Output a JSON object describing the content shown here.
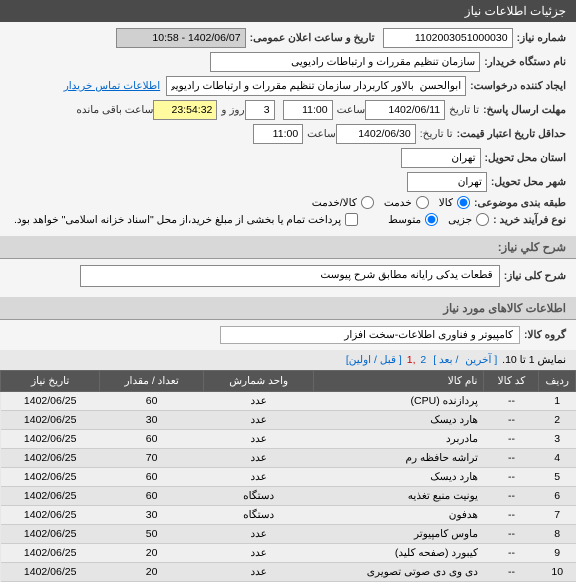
{
  "header": {
    "title": "جزئیات اطلاعات نیاز"
  },
  "form": {
    "need_no_label": "شماره نیاز:",
    "need_no": "1102003051000030",
    "announce_label": "تاریخ و ساعت اعلان عمومی:",
    "announce_val": "1402/06/07 - 10:58",
    "buyer_label": "نام دستگاه خریدار:",
    "buyer_val": "سازمان تنظیم مقررات و ارتباطات رادیویی",
    "requester_label": "ایجاد کننده درخواست:",
    "requester_val": "ابوالحسن  بالاور کاربردار سازمان تنظیم مقررات و ارتباطات رادیویی",
    "contact_link": "اطلاعات تماس خریدار",
    "deadline_label": "مهلت ارسال پاسخ:",
    "to_label": "تا تاریخ",
    "date1": "1402/06/11",
    "time_label": "ساعت",
    "time1": "11:00",
    "days": "3",
    "days_label": "روز و",
    "remain": "23:54:32",
    "remain_label": "ساعت باقی مانده",
    "min_valid_label": "حداقل تاریخ اعتبار قیمت:",
    "to_date_label": "تا تاریخ:",
    "date2": "1402/06/30",
    "time2": "11:00",
    "deliver_city_label": "استان محل تحویل:",
    "deliver_city": "تهران",
    "deliver_town_label": "شهر محل تحویل:",
    "deliver_town": "تهران",
    "category_label": "طبقه بندی موضوعی:",
    "cat_goods": "کالا",
    "cat_service": "خدمت",
    "cat_both": "کالا/خدمت",
    "process_label": "نوع فرآیند خرید :",
    "proc_small": "جزیی",
    "proc_medium": "متوسط",
    "pay_note": "پرداخت تمام یا بخشی از مبلغ خرید،از محل \"اسناد خزانه اسلامی\" خواهد بود."
  },
  "descSection": {
    "title": "شرح کلي نياز:",
    "label": "شرح کلی نیاز:",
    "value": "قطعات یدکی رایانه مطابق شرح پیوست"
  },
  "goodsSection": {
    "title": "اطلاعات کالاهای مورد نیاز",
    "group_label": "گروه کالا:",
    "group_value": "کامپیوتر و فناوری اطلاعات-سخت افزار"
  },
  "pager": {
    "text_prefix": "نمایش 1 تا 10.",
    "last": "[ آخرین",
    "next": "/ بعد ]",
    "p2": "2",
    "p1": ",1",
    "prev_first": "[ قبل / اولین]"
  },
  "table": {
    "headers": {
      "row": "ردیف",
      "code": "کد کالا",
      "name": "نام کالا",
      "unit": "واحد شمارش",
      "qty": "تعداد / مقدار",
      "date": "تاریخ نیاز"
    },
    "rows": [
      {
        "n": "1",
        "code": "--",
        "name": "پردازنده (CPU)",
        "unit": "عدد",
        "qty": "60",
        "date": "1402/06/25"
      },
      {
        "n": "2",
        "code": "--",
        "name": "هارد دیسک",
        "unit": "عدد",
        "qty": "30",
        "date": "1402/06/25"
      },
      {
        "n": "3",
        "code": "--",
        "name": "مادربرد",
        "unit": "عدد",
        "qty": "60",
        "date": "1402/06/25"
      },
      {
        "n": "4",
        "code": "--",
        "name": "تراشه حافظه رم",
        "unit": "عدد",
        "qty": "70",
        "date": "1402/06/25"
      },
      {
        "n": "5",
        "code": "--",
        "name": "هارد دیسک",
        "unit": "عدد",
        "qty": "60",
        "date": "1402/06/25"
      },
      {
        "n": "6",
        "code": "--",
        "name": "یونیت منبع تغذیه",
        "unit": "دستگاه",
        "qty": "60",
        "date": "1402/06/25"
      },
      {
        "n": "7",
        "code": "--",
        "name": "هدفون",
        "unit": "دستگاه",
        "qty": "30",
        "date": "1402/06/25"
      },
      {
        "n": "8",
        "code": "--",
        "name": "ماوس کامپیوتر",
        "unit": "عدد",
        "qty": "50",
        "date": "1402/06/25"
      },
      {
        "n": "9",
        "code": "--",
        "name": "کیبورد (صفحه کلید)",
        "unit": "عدد",
        "qty": "20",
        "date": "1402/06/25"
      },
      {
        "n": "10",
        "code": "--",
        "name": "دی وی دی صوتی تصویری",
        "unit": "عدد",
        "qty": "20",
        "date": "1402/06/25"
      }
    ]
  }
}
